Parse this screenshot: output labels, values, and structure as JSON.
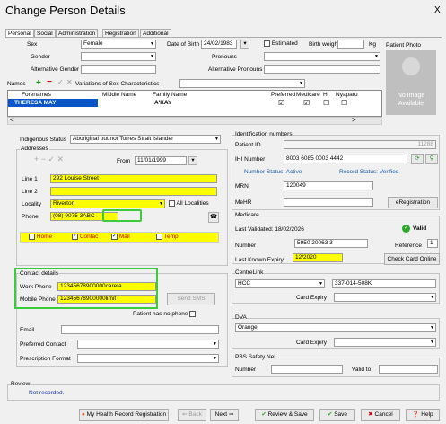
{
  "window": {
    "title": "Change Person Details",
    "close": "X"
  },
  "tabs": [
    "Personal",
    "Social",
    "Administration",
    "Registration",
    "Additional"
  ],
  "top": {
    "sex_label": "Sex",
    "sex_value": "Female",
    "dob_label": "Date of Birth",
    "dob_value": "24/02/1983",
    "estimated": "Estimated",
    "birth_weight": "Birth weight",
    "kg": "Kg",
    "photo_label": "Patient Photo",
    "gender_label": "Gender",
    "pronouns_label": "Pronouns",
    "alt_gender_label": "Alternative Gender",
    "alt_pronouns_label": "Alternative Pronouns",
    "names_label": "Names",
    "variations_label": "Variations of Sex Characteristics",
    "no_image": "No Image Available"
  },
  "names_table": {
    "headers": [
      "Forenames",
      "Middle Name",
      "Family Name",
      "Preferred",
      "Medicare",
      "HI",
      "Nyaparu"
    ],
    "row": {
      "forenames": "THERESA MAY",
      "middle": "",
      "family": "A'KAY",
      "preferred": "☑",
      "medicare": "☑",
      "hi": "☐",
      "nyaparu": "☐"
    }
  },
  "left": {
    "indigenous_label": "Indigenous Status",
    "indigenous_value": "Aboriginal but not Torres Strait Islander",
    "addresses_label": "Addresses",
    "from_label": "From",
    "from_value": "11/01/1999",
    "line1_label": "Line 1",
    "line1_value": "292 Louise Street",
    "line2_label": "Line 2",
    "locality_label": "Locality",
    "locality_value": "Riverton",
    "all_localities": "All Localities",
    "phone_label": "Phone",
    "phone_value": "(08) 9075 3ABC",
    "home": "Home",
    "contact": "Contac",
    "mail": "Mail",
    "temp": "Temp",
    "contact_details": "Contact details",
    "work_phone_label": "Work Phone",
    "work_phone_value": "12345678900000careta",
    "mobile_label": "Mobile Phone",
    "mobile_value": "12345678900000limit",
    "send_sms": "Send SMS",
    "no_phone": "Patient has no phone",
    "email_label": "Email",
    "pref_contact_label": "Preferred Contact",
    "presc_label": "Prescription Format"
  },
  "right": {
    "ident_label": "Identification numbers",
    "patient_id_label": "Patient ID",
    "patient_id_value": "11288",
    "ihi_label": "IHI Number",
    "ihi_value": "8003 6085 0003 4442",
    "number_status": "Number Status: Active",
    "record_status": "Record Status: Verified",
    "mrn_label": "MRN",
    "mrn_value": "120049",
    "mehr_label": "MeHR",
    "ereg_button": "eRegistration",
    "medicare_label": "Medicare",
    "last_validated": "Last Validated: 18/02/2026",
    "valid": "Valid",
    "number_label": "Number",
    "number_value": "5950 20063 3",
    "reference_label": "Reference",
    "reference_value": "1",
    "last_expiry_label": "Last Known Expiry",
    "last_expiry_value": "12/2020",
    "check_card": "Check Card Online",
    "centrelink_label": "CentreLink",
    "centrelink_type": "HCC",
    "centrelink_number": "337-014-508K",
    "card_expiry": "Card Expiry",
    "dva_label": "DVA",
    "dva_value": "Orange",
    "card_expiry2": "Card Expiry",
    "pbs_label": "PBS Safety Net",
    "pbs_number": "Number",
    "valid_to": "Valid to"
  },
  "review": {
    "label": "Review",
    "text": "Not recorded."
  },
  "footer": {
    "mhr": "My Health Record Registration",
    "back": "Back",
    "next": "Next",
    "review_save": "Review & Save",
    "save": "Save",
    "cancel": "Cancel",
    "help": "Help"
  }
}
